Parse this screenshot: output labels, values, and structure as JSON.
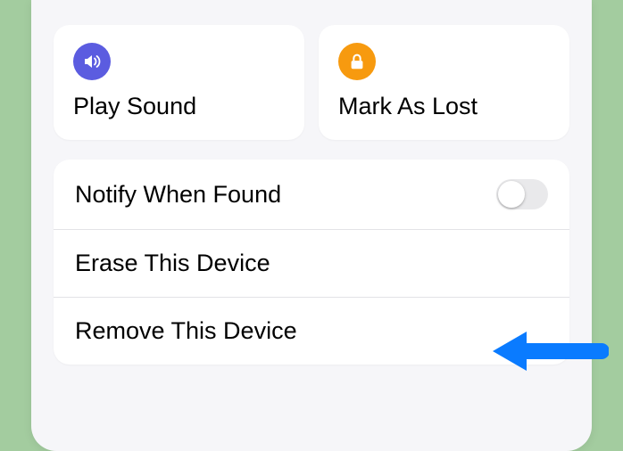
{
  "actions": {
    "play_sound_label": "Play Sound",
    "mark_as_lost_label": "Mark As Lost"
  },
  "options": {
    "notify_when_found_label": "Notify When Found",
    "erase_device_label": "Erase This Device",
    "remove_device_label": "Remove This Device"
  },
  "colors": {
    "accent_purple": "#5b5ce0",
    "accent_orange": "#f79a0f",
    "arrow_blue": "#0a7bff"
  }
}
